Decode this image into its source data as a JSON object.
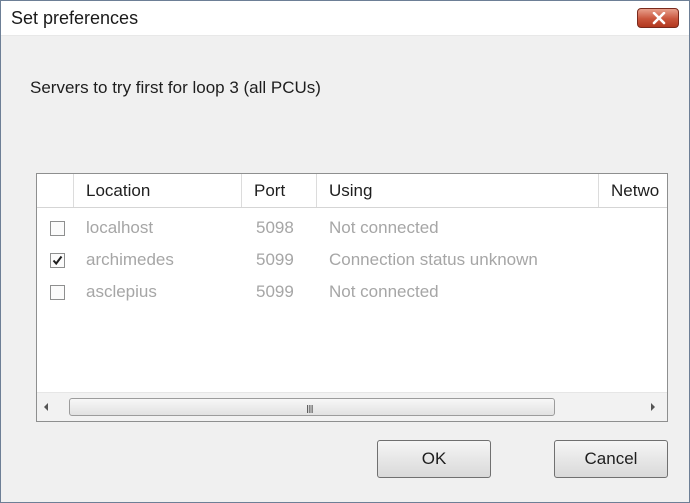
{
  "window": {
    "title": "Set preferences"
  },
  "prompt": "Servers to try first for loop 3 (all PCUs)",
  "table": {
    "columns": [
      "",
      "Location",
      "Port",
      "Using",
      "Netwo"
    ],
    "rows": [
      {
        "checked": false,
        "location": "localhost",
        "port": "5098",
        "using": "Not connected"
      },
      {
        "checked": true,
        "location": "archimedes",
        "port": "5099",
        "using": "Connection status unknown"
      },
      {
        "checked": false,
        "location": "asclepius",
        "port": "5099",
        "using": "Not connected"
      }
    ]
  },
  "scrollbar": {
    "grip": "III"
  },
  "buttons": {
    "ok": "OK",
    "cancel": "Cancel"
  },
  "colors": {
    "close_button": "#c9553c",
    "disabled_text": "#a6a6a6"
  }
}
